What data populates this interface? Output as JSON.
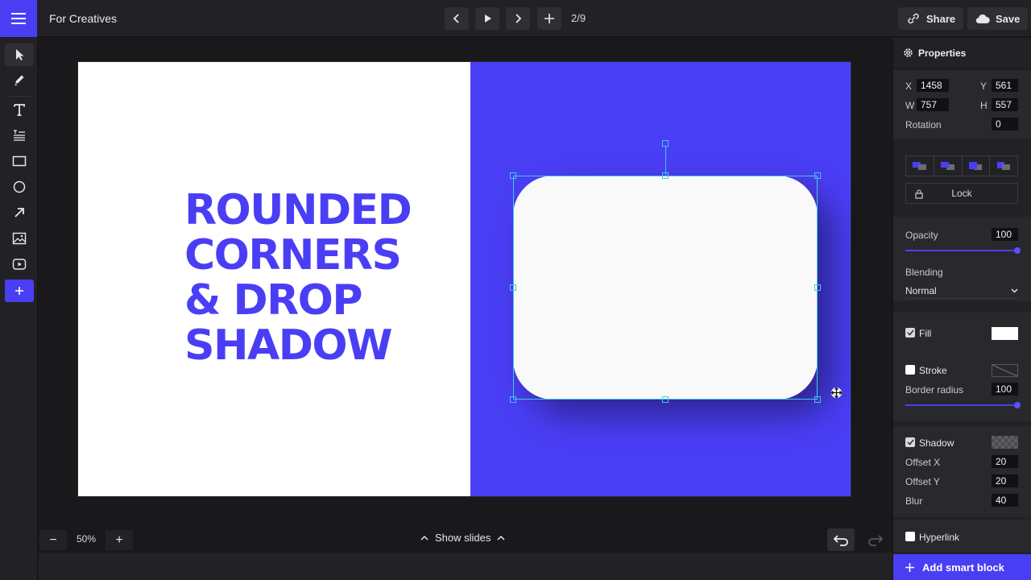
{
  "topbar": {
    "doc_title": "For Creatives",
    "slide_position": "2/9",
    "share_label": "Share",
    "save_label": "Save"
  },
  "slide": {
    "headline_lines": [
      "ROUNDED",
      "CORNERS",
      "& DROP",
      "SHADOW"
    ]
  },
  "bottombar": {
    "zoom_value": "50%",
    "show_slides_label": "Show slides"
  },
  "panel": {
    "title": "Properties",
    "x_label": "X",
    "x_value": "1458",
    "y_label": "Y",
    "y_value": "561",
    "w_label": "W",
    "w_value": "757",
    "h_label": "H",
    "h_value": "557",
    "rotation_label": "Rotation",
    "rotation_value": "0",
    "lock_label": "Lock",
    "opacity_label": "Opacity",
    "opacity_value": "100",
    "blending_label": "Blending",
    "blending_value": "Normal",
    "fill_label": "Fill",
    "stroke_label": "Stroke",
    "border_radius_label": "Border radius",
    "border_radius_value": "100",
    "shadow_label": "Shadow",
    "offset_x_label": "Offset X",
    "offset_x_value": "20",
    "offset_y_label": "Offset Y",
    "offset_y_value": "20",
    "blur_label": "Blur",
    "blur_value": "40",
    "hyperlink_label": "Hyperlink",
    "add_smart_block_label": "Add smart block"
  },
  "colors": {
    "accent": "#4a3ef5",
    "selection": "#47c6e6",
    "fill_swatch": "#ffffff"
  },
  "icons": [
    "menu-icon",
    "chevron-left-icon",
    "play-icon",
    "chevron-right-icon",
    "plus-icon",
    "link-icon",
    "cloud-icon",
    "cursor-icon",
    "pen-icon",
    "text-icon",
    "paragraph-icon",
    "rectangle-icon",
    "circle-icon",
    "arrow-icon",
    "image-icon",
    "video-icon",
    "gear-icon",
    "lock-icon",
    "undo-icon",
    "redo-icon",
    "move-icon"
  ]
}
